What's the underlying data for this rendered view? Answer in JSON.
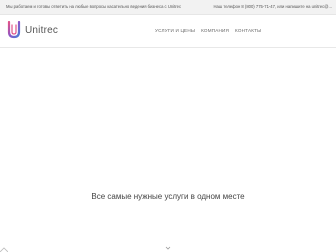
{
  "topbar": {
    "message": "Мы работаем и готовы ответить на любые вопросы касательно ведения бизнеса с Unitrec",
    "contact": "Наш телефон 8 (800) 775-71-47, или напишите на unitrec@..."
  },
  "header": {
    "logo_text": "Unitrec",
    "logo_icon": "unitrec-u-icon",
    "nav": [
      {
        "label": "УСЛУГИ И ЦЕНЫ"
      },
      {
        "label": "КОМПАНИЯ"
      },
      {
        "label": "КОНТАКТЫ"
      }
    ]
  },
  "hero": {
    "title": "Все самые нужные услуги в одном месте"
  },
  "icons": {
    "scroll": "chevron-down-icon"
  },
  "colors": {
    "brand_pink": "#e0538a",
    "brand_blue": "#4a7fd4",
    "brand_purple": "#8a56c7"
  }
}
